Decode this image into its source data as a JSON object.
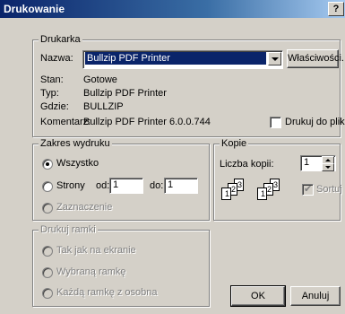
{
  "dialog": {
    "title": "Drukowanie",
    "help": "?"
  },
  "printer": {
    "legend": "Drukarka",
    "name_label": "Nazwa:",
    "name_value": "Bullzip PDF Printer",
    "properties_button": "Właściwości...",
    "status_label": "Stan:",
    "status_value": "Gotowe",
    "type_label": "Typ:",
    "type_value": "Bullzip PDF Printer",
    "where_label": "Gdzie:",
    "where_value": "BULLZIP",
    "comment_label": "Komentarz:",
    "comment_value": "Bullzip PDF Printer 6.0.0.744",
    "print_to_file": "Drukuj do pliku"
  },
  "range": {
    "legend": "Zakres wydruku",
    "all": "Wszystko",
    "pages": "Strony",
    "from_label": "od:",
    "from_value": "1",
    "to_label": "do:",
    "to_value": "1",
    "selection": "Zaznaczenie"
  },
  "copies": {
    "legend": "Kopie",
    "count_label": "Liczba kopii:",
    "count_value": "1",
    "collate": "Sortuj",
    "page_nums": [
      "1",
      "2",
      "3"
    ]
  },
  "frames": {
    "legend": "Drukuj ramki",
    "as_on_screen": "Tak jak na ekranie",
    "selected_frame": "Wybraną ramkę",
    "each_frame": "Każdą ramkę z osobna"
  },
  "buttons": {
    "ok": "OK",
    "cancel": "Anuluj"
  }
}
